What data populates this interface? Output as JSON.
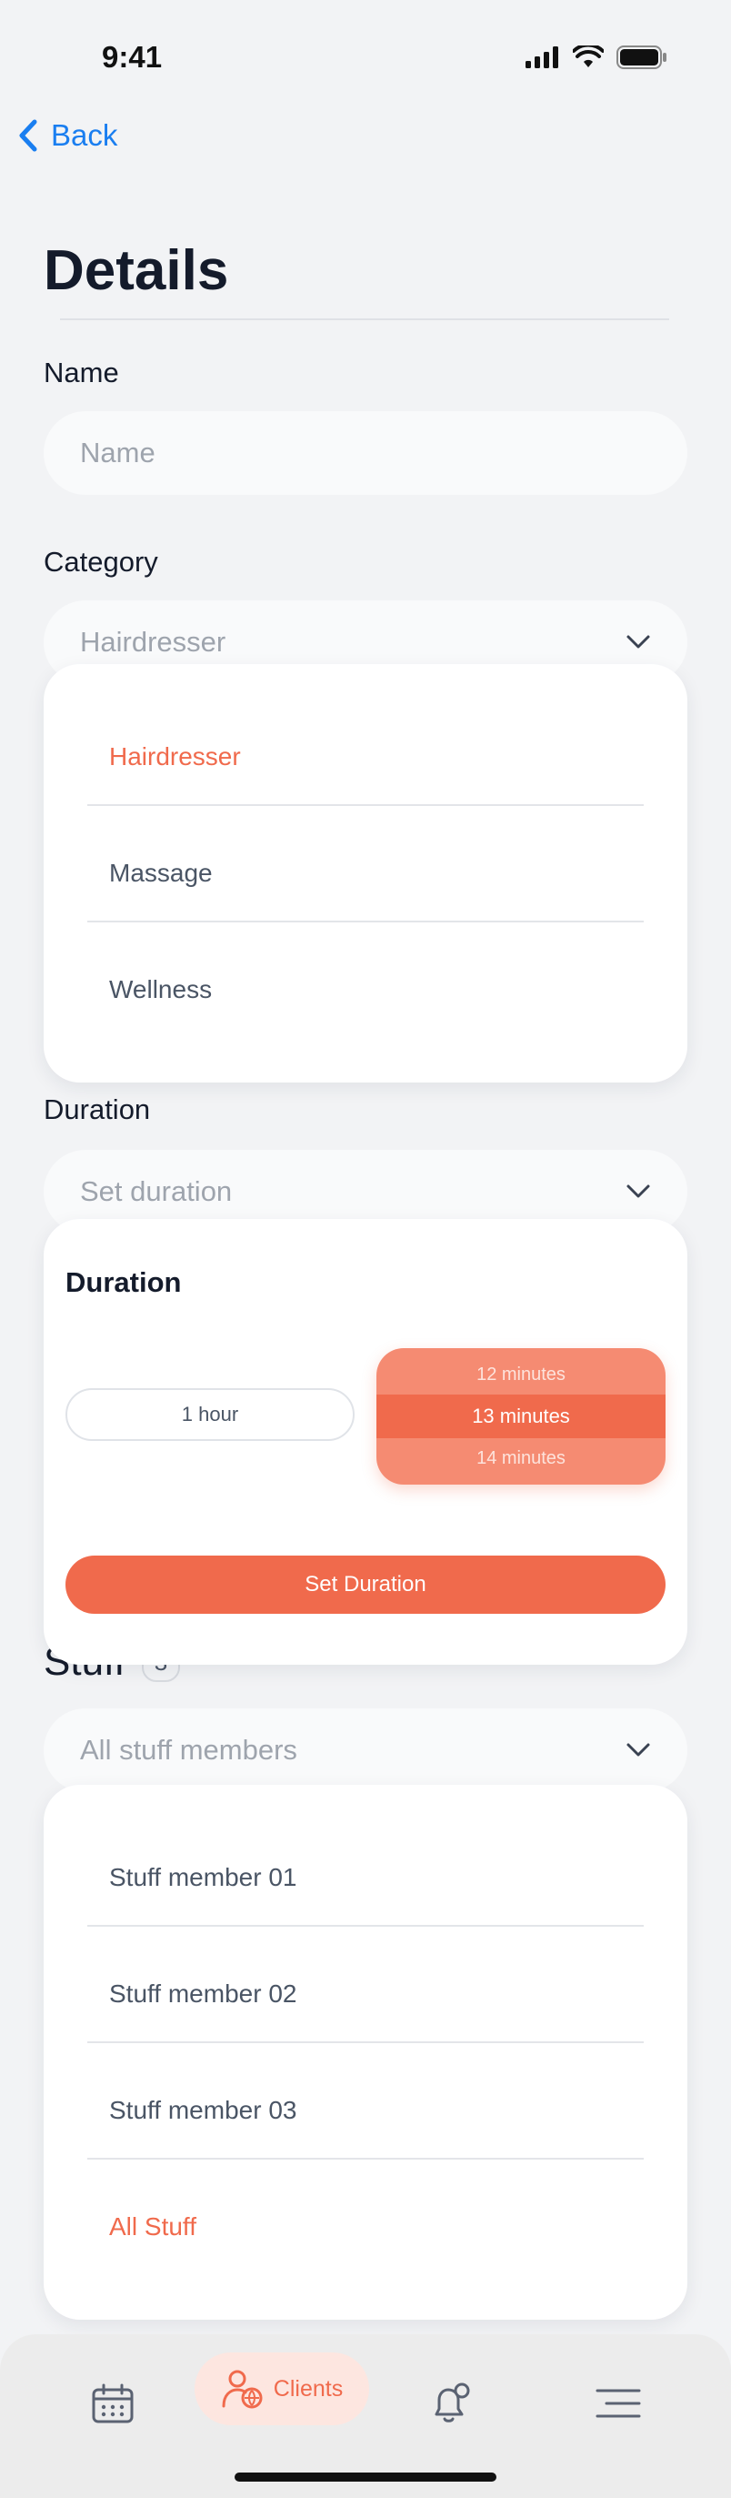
{
  "status_bar": {
    "time": "9:41"
  },
  "nav": {
    "back_label": "Back"
  },
  "page": {
    "title": "Details"
  },
  "name_field": {
    "label": "Name",
    "placeholder": "Name"
  },
  "category": {
    "label": "Category",
    "selected": "Hairdresser",
    "options": [
      "Hairdresser",
      "Massage",
      "Wellness"
    ]
  },
  "duration": {
    "label": "Duration",
    "placeholder": "Set duration",
    "popup_title": "Duration",
    "hours_value": "1 hour",
    "minutes_options": [
      "12 minutes",
      "13 minutes",
      "14 minutes"
    ],
    "set_button": "Set Duration"
  },
  "stuff": {
    "label": "Stuff",
    "count": "3",
    "placeholder": "All stuff members",
    "options": [
      "Stuff member 01",
      "Stuff member 02",
      "Stuff member 03",
      "All Stuff"
    ]
  },
  "tabbar": {
    "active_label": "Clients",
    "tabs": [
      "calendar-icon",
      "clients-icon",
      "notifications-icon",
      "menu-icon"
    ]
  },
  "colors": {
    "accent": "#f06a4c",
    "link": "#1a7ef0",
    "background": "#f2f3f5"
  }
}
